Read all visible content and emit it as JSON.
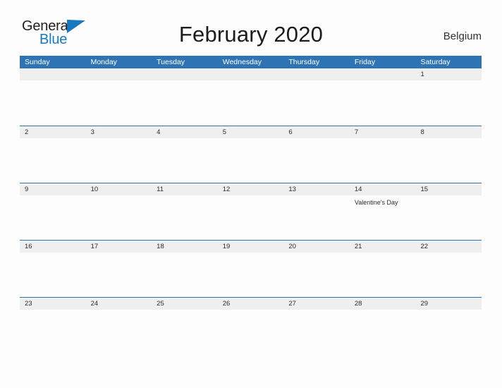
{
  "branding": {
    "logo_word1": "General",
    "logo_word2": "Blue",
    "logo_flag_icon": "blue-triangle-flag-icon"
  },
  "header": {
    "title": "February 2020",
    "country": "Belgium"
  },
  "colors": {
    "header_blue": "#2e74b5",
    "band_gray": "#efefef",
    "logo_blue": "#1878be",
    "page_background": "#fdfdfd",
    "text": "#2b2b2b"
  },
  "calendar": {
    "month": "February",
    "year": "2020",
    "weekdays": [
      "Sunday",
      "Monday",
      "Tuesday",
      "Wednesday",
      "Thursday",
      "Friday",
      "Saturday"
    ],
    "weeks": [
      [
        {
          "date": "",
          "events": []
        },
        {
          "date": "",
          "events": []
        },
        {
          "date": "",
          "events": []
        },
        {
          "date": "",
          "events": []
        },
        {
          "date": "",
          "events": []
        },
        {
          "date": "",
          "events": []
        },
        {
          "date": "1",
          "events": []
        }
      ],
      [
        {
          "date": "2",
          "events": []
        },
        {
          "date": "3",
          "events": []
        },
        {
          "date": "4",
          "events": []
        },
        {
          "date": "5",
          "events": []
        },
        {
          "date": "6",
          "events": []
        },
        {
          "date": "7",
          "events": []
        },
        {
          "date": "8",
          "events": []
        }
      ],
      [
        {
          "date": "9",
          "events": []
        },
        {
          "date": "10",
          "events": []
        },
        {
          "date": "11",
          "events": []
        },
        {
          "date": "12",
          "events": []
        },
        {
          "date": "13",
          "events": []
        },
        {
          "date": "14",
          "events": [
            "Valentine's Day"
          ]
        },
        {
          "date": "15",
          "events": []
        }
      ],
      [
        {
          "date": "16",
          "events": []
        },
        {
          "date": "17",
          "events": []
        },
        {
          "date": "18",
          "events": []
        },
        {
          "date": "19",
          "events": []
        },
        {
          "date": "20",
          "events": []
        },
        {
          "date": "21",
          "events": []
        },
        {
          "date": "22",
          "events": []
        }
      ],
      [
        {
          "date": "23",
          "events": []
        },
        {
          "date": "24",
          "events": []
        },
        {
          "date": "25",
          "events": []
        },
        {
          "date": "26",
          "events": []
        },
        {
          "date": "27",
          "events": []
        },
        {
          "date": "28",
          "events": []
        },
        {
          "date": "29",
          "events": []
        }
      ]
    ]
  }
}
